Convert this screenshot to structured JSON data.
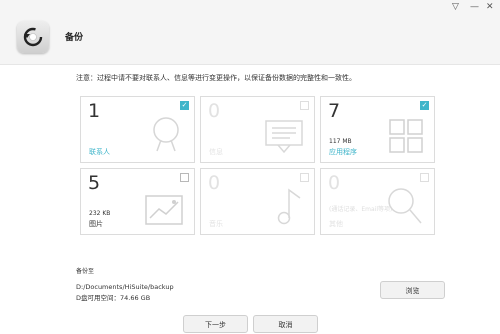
{
  "window": {
    "menu_glyph": "▽",
    "min_glyph": "—",
    "close_glyph": "✕"
  },
  "header": {
    "title": "备份",
    "logo_icon": "backup-app-icon"
  },
  "notice": "注意：过程中请不要对联系人、信息等进行变更操作，以保证备份数据的完整性和一致性。",
  "accent_color": "#3fb5ca",
  "cards": [
    {
      "count": "1",
      "size": "",
      "label": "联系人",
      "checked": true,
      "enabled": true,
      "icon": "contact-icon"
    },
    {
      "count": "0",
      "size": "",
      "label": "信息",
      "checked": false,
      "enabled": false,
      "icon": "message-icon"
    },
    {
      "count": "7",
      "size": "117 MB",
      "label": "应用程序",
      "checked": true,
      "enabled": true,
      "icon": "apps-grid-icon"
    },
    {
      "count": "5",
      "size": "232 KB",
      "label": "图片",
      "checked": false,
      "enabled": true,
      "icon": "image-icon"
    },
    {
      "count": "0",
      "size": "",
      "label": "音乐",
      "checked": false,
      "enabled": false,
      "icon": "music-note-icon"
    },
    {
      "count": "0",
      "size": "(通话记录、Email等项)",
      "label": "其他",
      "checked": false,
      "enabled": false,
      "icon": "search-icon"
    }
  ],
  "destination": {
    "label": "备份至",
    "path": "D:/Documents/HiSuite/backup",
    "free_space": "D盘可用空间：74.66 GB",
    "browse_label": "浏览"
  },
  "footer": {
    "next_label": "下一步",
    "cancel_label": "取消"
  }
}
